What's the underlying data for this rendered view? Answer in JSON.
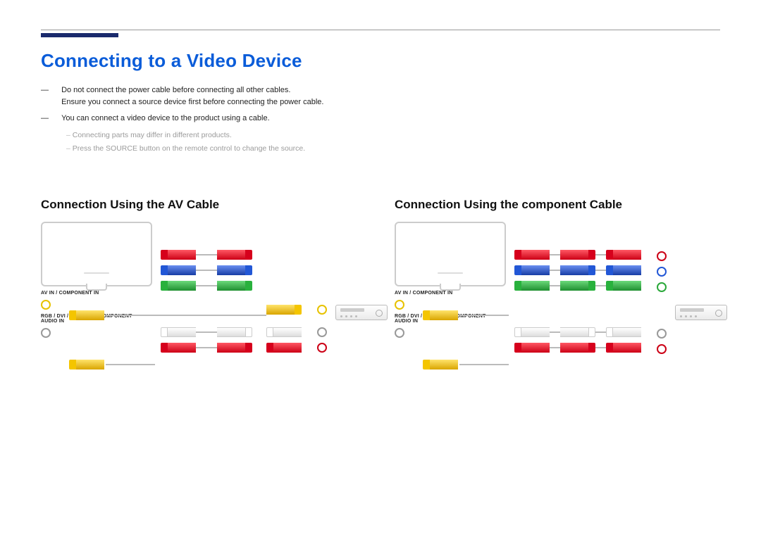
{
  "header": {
    "title": "Connecting to a Video Device"
  },
  "notes": {
    "n1_label": "―",
    "n1_line1": "Do not connect the power cable before connecting all other cables.",
    "n1_line2": "Ensure you connect a source device first before connecting the power cable.",
    "n2_label": "―",
    "n2_text": "You can connect a video device to the product using a cable.",
    "sub1": "Connecting parts may differ in different products.",
    "sub2_pre": "Press the ",
    "sub2_btn": "SOURCE",
    "sub2_post": " button on the remote control to change the source."
  },
  "left": {
    "heading": "Connection Using the AV Cable",
    "label1": "AV IN / COMPONENT IN",
    "label2": "RGB / DVI / HDMI / AV / COMPONENT AUDIO IN"
  },
  "right": {
    "heading": "Connection Using the component Cable",
    "label1": "AV IN / COMPONENT IN",
    "label2": "RGB / DVI / HDMI / AV / COMPONENT AUDIO IN"
  }
}
